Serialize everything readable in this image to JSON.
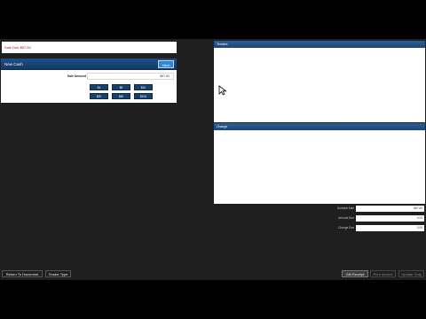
{
  "sale_due": "Sale Due $67.60",
  "tender_panel": {
    "title": "New Cash",
    "tender_button": "Next",
    "amount_label": "Sale Amount",
    "amount_value": "$67.60",
    "quick_amounts": [
      "$1",
      "$5",
      "$10",
      "$20",
      "$50",
      "$100"
    ]
  },
  "tenders_panel": {
    "title": "Tenders"
  },
  "change_panel": {
    "title": "Change"
  },
  "summary": [
    {
      "label": "Subtotal Sale",
      "value": "$67.60"
    },
    {
      "label": "Amount Due",
      "value": "0.00"
    },
    {
      "label": "Change Due",
      "value": "0.00"
    }
  ],
  "bottom": {
    "return_label": "Return To Document",
    "tender_type_label": "Tender Type",
    "gift_receipt_label": "Gift Receipt",
    "print_invoice_label": "Print Invoice",
    "update_only_label": "Update Only"
  }
}
